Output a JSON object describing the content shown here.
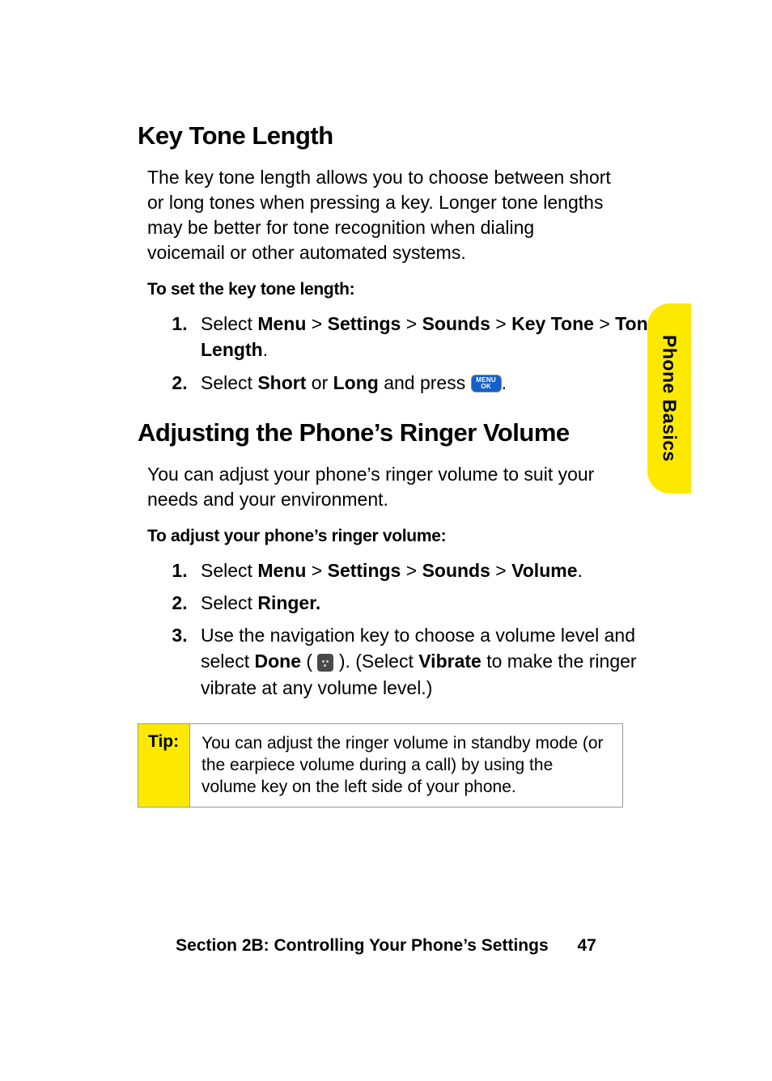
{
  "tab": {
    "label": "Phone Basics"
  },
  "sec1": {
    "heading": "Key Tone Length",
    "body": "The key tone length allows you to choose between short or long tones when pressing a key. Longer tone lengths may be better for tone recognition when dialing voicemail or other automated systems.",
    "subhead": "To set the key tone length:",
    "step1": {
      "pre": "Select ",
      "b1": "Menu",
      "s1": " > ",
      "b2": "Settings",
      "s2": " > ",
      "b3": "Sounds",
      "s3": " > ",
      "b4": "Key Tone",
      "s4": " > ",
      "b5": "Tone Length",
      "post": "."
    },
    "step2": {
      "pre": "Select ",
      "b1": "Short",
      "mid": " or ",
      "b2": "Long",
      "post1": " and press ",
      "post2": "."
    }
  },
  "sec2": {
    "heading": "Adjusting the Phone’s Ringer Volume",
    "body": "You can adjust your phone’s ringer volume to suit your needs and your environment.",
    "subhead": "To adjust your phone’s ringer volume:",
    "step1": {
      "pre": "Select ",
      "b1": "Menu",
      "s1": " > ",
      "b2": "Settings",
      "s2": " > ",
      "b3": "Sounds",
      "s3": " > ",
      "b4": "Volume",
      "post": "."
    },
    "step2": {
      "pre": "Select ",
      "b1": "Ringer."
    },
    "step3": {
      "pre": "Use the navigation key to choose a volume level and select ",
      "b1": "Done",
      "mid1": " ( ",
      "mid2": " ). (Select ",
      "b2": "Vibrate",
      "post": " to make the ringer vibrate at any volume level.)"
    }
  },
  "tip": {
    "label": "Tip:",
    "content": "You can adjust the ringer volume in standby mode (or the earpiece volume during a call) by using the volume key on the left side of your phone."
  },
  "footer": {
    "text": "Section 2B: Controlling Your Phone’s Settings",
    "page": "47"
  },
  "icons": {
    "menu_ok_l1": "MENU",
    "menu_ok_l2": "OK"
  }
}
